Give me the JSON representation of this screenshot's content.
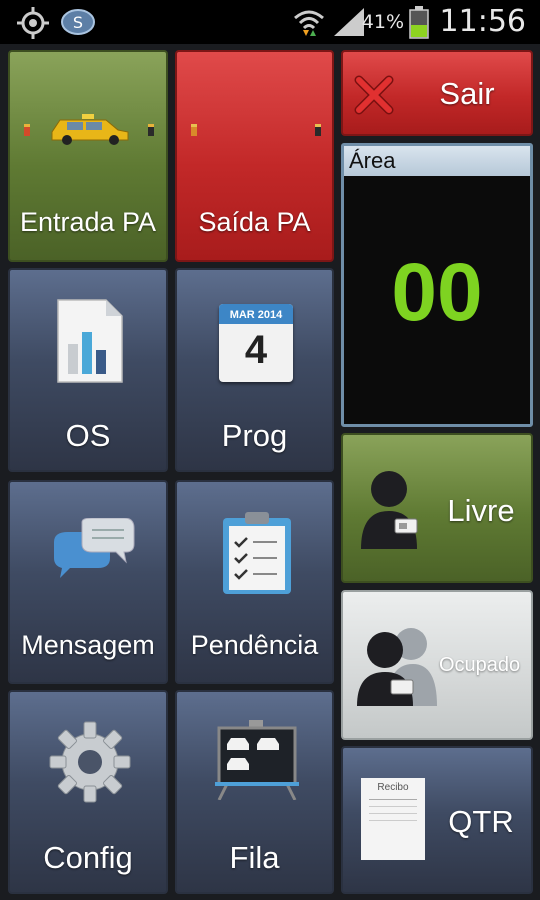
{
  "status_bar": {
    "battery_percent": "41%",
    "time": "11:56",
    "icons": [
      "gps-icon",
      "app-icon",
      "wifi-icon",
      "signal-icon",
      "battery-icon"
    ]
  },
  "tiles": {
    "entrada": {
      "label": "Entrada PA",
      "icon": "taxi-icon"
    },
    "saida": {
      "label": "Saída PA",
      "icon": "flag-icon"
    },
    "sair": {
      "label": "Sair",
      "icon": "close-icon"
    },
    "os": {
      "label": "OS",
      "icon": "report-chart-icon"
    },
    "prog": {
      "label": "Prog",
      "icon": "calendar-icon",
      "calendar_month": "MAR 2014",
      "calendar_day": "4"
    },
    "mensagem": {
      "label": "Mensagem",
      "icon": "chat-bubbles-icon"
    },
    "pendencia": {
      "label": "Pendência",
      "icon": "clipboard-icon"
    },
    "config": {
      "label": "Config",
      "icon": "gear-icon"
    },
    "fila": {
      "label": "Fila",
      "icon": "queue-board-icon"
    },
    "livre": {
      "label": "Livre",
      "icon": "driver-icon"
    },
    "ocupado": {
      "label": "Ocupado",
      "icon": "drivers-busy-icon"
    },
    "qtr": {
      "label": "QTR",
      "icon": "receipt-icon",
      "receipt_title": "Recibo"
    }
  },
  "area_panel": {
    "title": "Área",
    "value": "00"
  },
  "colors": {
    "green": "#5f7a33",
    "red": "#c22828",
    "blue": "#3f4b63",
    "area_value": "#7ed321"
  }
}
